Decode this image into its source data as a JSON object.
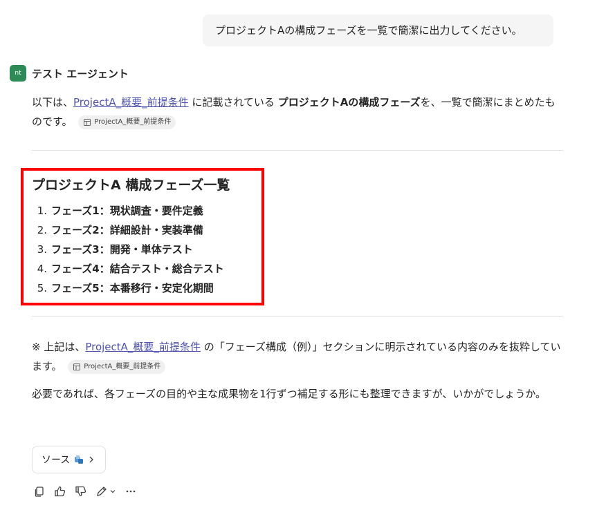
{
  "user_message": "プロジェクトAの構成フェーズを一覧で簡潔に出力してください。",
  "agent": {
    "avatar_text": "nt",
    "name": "テスト エージェント"
  },
  "intro": {
    "prefix": "以下は、",
    "link_text": "ProjectA_概要_前提条件",
    "mid": " に記載されている ",
    "bold": "プロジェクトAの構成フェーズ",
    "suffix": "を、一覧で簡潔にまとめたものです。",
    "chip_label": "ProjectA_概要_前提条件"
  },
  "phase_section": {
    "title": "プロジェクトA 構成フェーズ一覧",
    "items": [
      {
        "num": "1.",
        "label": "フェーズ1：現状調査・要件定義"
      },
      {
        "num": "2.",
        "label": "フェーズ2：詳細設計・実装準備"
      },
      {
        "num": "3.",
        "label": "フェーズ3：開発・単体テスト"
      },
      {
        "num": "4.",
        "label": "フェーズ4：結合テスト・総合テスト"
      },
      {
        "num": "5.",
        "label": "フェーズ5：本番移行・安定化期間"
      }
    ]
  },
  "note": {
    "prefix": "※ 上記は、",
    "link_text": "ProjectA_概要_前提条件",
    "suffix": " の「フェーズ構成（例）」セクションに明示されている内容のみを抜粋しています。",
    "chip_label": "ProjectA_概要_前提条件"
  },
  "followup": "必要であれば、各フェーズの目的や主な成果物を1行ずつ補足する形にも整理できますが、いかがでしょうか。",
  "source_button": {
    "label": "ソース"
  },
  "colors": {
    "highlight_box": "#ff0000",
    "link": "#4f52b2",
    "avatar": "#2e8b57"
  },
  "actions": [
    "copy-icon",
    "thumbs-up-icon",
    "thumbs-down-icon",
    "edit-icon",
    "chevron-down-icon",
    "more-icon"
  ]
}
